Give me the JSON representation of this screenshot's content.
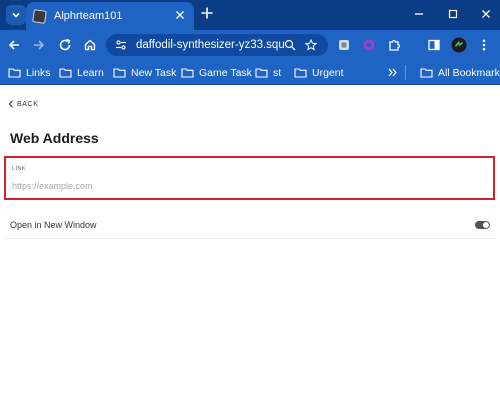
{
  "browser": {
    "tab": {
      "title": "Alphrteam101"
    },
    "omnibox": {
      "url": "daffodil-synthesizer-yz33.squ..."
    },
    "bookmarks": [
      {
        "label": "Links"
      },
      {
        "label": "Learn"
      },
      {
        "label": "New Task"
      },
      {
        "label": "Game Task"
      },
      {
        "label": "st"
      },
      {
        "label": "Urgent"
      }
    ],
    "all_bookmarks_label": "All Bookmarks"
  },
  "page": {
    "back_label": "BACK",
    "title": "Web Address",
    "link_field": {
      "label": "LINK",
      "value": "",
      "placeholder": "https://example.com"
    },
    "new_window_toggle": {
      "label": "Open in New Window",
      "on": true
    }
  },
  "colors": {
    "chrome_dark": "#0b3d86",
    "chrome": "#1f63c4",
    "highlight_border": "#d3202e"
  }
}
